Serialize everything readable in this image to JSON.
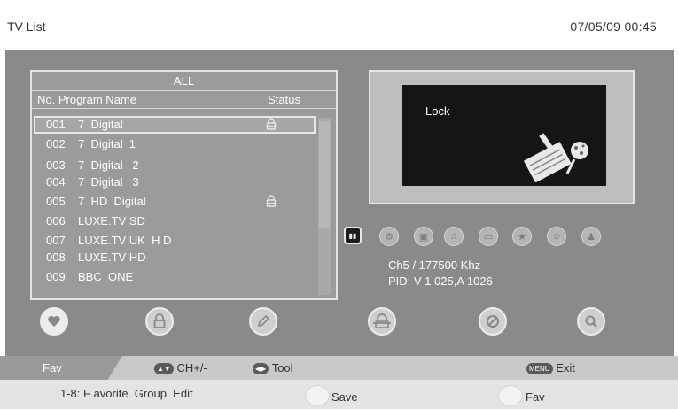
{
  "header": {
    "title": "TV List",
    "datetime": "07/05/09  00:45"
  },
  "list": {
    "group": "ALL",
    "columns": {
      "program": "No. Program Name",
      "status": "Status"
    },
    "rows": [
      {
        "num": "001",
        "name": "7  Digital",
        "locked": true,
        "selected": true
      },
      {
        "num": "002",
        "name": "7  Digital  1",
        "locked": false
      },
      {
        "num": "003",
        "name": "7  Digital   2",
        "locked": false
      },
      {
        "num": "004",
        "name": "7  Digital   3",
        "locked": false
      },
      {
        "num": "005",
        "name": "7  HD  Digital",
        "locked": true
      },
      {
        "num": "006",
        "name": "LUXE.TV SD",
        "locked": false
      },
      {
        "num": "007",
        "name": "LUXE.TV UK  H D",
        "locked": false
      },
      {
        "num": "008",
        "name": "LUXE.TV HD",
        "locked": false
      },
      {
        "num": "009",
        "name": "BBC  ONE",
        "locked": false
      }
    ]
  },
  "preview": {
    "status": "Lock"
  },
  "info": {
    "frequency": "Ch5 / 177500  Khz",
    "pid": "PID: V 1 025,A 1026"
  },
  "category_icons": [
    "list-icon",
    "gear-icon",
    "film-icon",
    "music-icon",
    "folder-icon",
    "sports-icon",
    "kids-icon",
    "person-icon"
  ],
  "actions": [
    "heart-icon",
    "lock-icon",
    "pencil-icon",
    "skip-icon",
    "delete-icon",
    "search-icon"
  ],
  "helpbar": {
    "fav": "Fav",
    "ch_key": "▲▼",
    "ch": "CH+/-",
    "tool_key": "◀▶",
    "tool": "Tool",
    "menu_key": "MENU",
    "exit": "Exit"
  },
  "footer": {
    "text": "1-8: F avorite  Group  Edit",
    "save": "Save",
    "fav": "Fav"
  },
  "colors": {
    "stage": "#8a8a8a",
    "panel_border": "#e4e4e4",
    "preview_bg": "#151515"
  }
}
